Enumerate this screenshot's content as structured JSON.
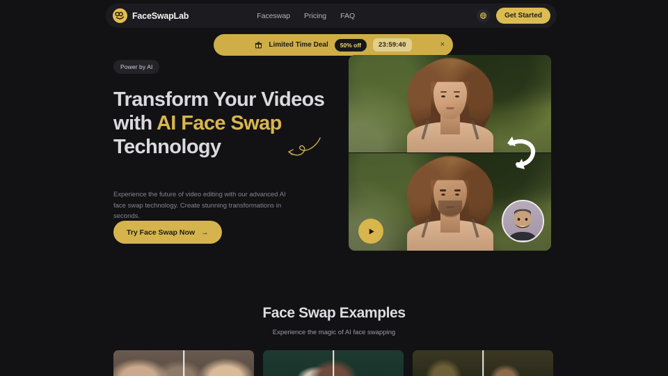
{
  "nav": {
    "brand_name": "FaceSwapLab",
    "logo_icon": "face-infinity-logo-icon",
    "links": [
      {
        "label": "Faceswap"
      },
      {
        "label": "Pricing"
      },
      {
        "label": "FAQ"
      }
    ],
    "language_icon": "globe-icon",
    "cta_label": "Get Started"
  },
  "promo": {
    "gift_icon": "gift-icon",
    "label": "Limited Time Deal",
    "badge": "50% off",
    "timer": "23:59:40",
    "close_icon": "close-icon",
    "close_label": "×"
  },
  "hero": {
    "badge": "Power by AI",
    "headline_part1": "Transform Your Videos with ",
    "headline_accent": "AI Face Swap",
    "headline_part2": " Technology",
    "subtext": "Experience the future of video editing with our advanced AI face swap technology. Create stunning transformations in seconds.",
    "cta_label": "Try Face Swap Now",
    "cta_arrow": "→",
    "swirl_icon": "curly-arrow-decoration-icon",
    "media": {
      "swap_icon": "swap-arrows-icon",
      "play_icon": "play-icon",
      "avatar_icon": "source-face-avatar",
      "top_frame_label": "original-video-frame",
      "bottom_frame_label": "swapped-video-frame"
    }
  },
  "examples": {
    "title": "Face Swap Examples",
    "subtitle": "Experience the magic of AI face swapping",
    "cards": [
      {
        "name": "example-card-1"
      },
      {
        "name": "example-card-2"
      },
      {
        "name": "example-card-3"
      }
    ]
  },
  "colors": {
    "background": "#121215",
    "surface": "#1c1c20",
    "accent": "#d9b64e",
    "accent_dark": "#cfae47",
    "text_primary": "#d9d9de",
    "text_muted": "#84848f"
  }
}
